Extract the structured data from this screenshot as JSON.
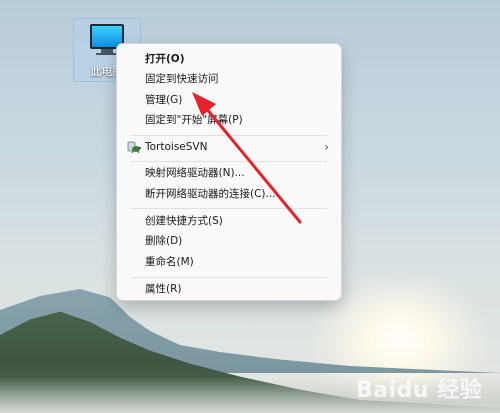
{
  "desktop": {
    "icon_label": "此电脑"
  },
  "context_menu": {
    "items": [
      {
        "label": "打开(O)"
      },
      {
        "label": "固定到快速访问"
      },
      {
        "label": "管理(G)"
      },
      {
        "label": "固定到\"开始\"屏幕(P)"
      },
      {
        "label": "TortoiseSVN",
        "icon": "tortoisesvn-icon",
        "has_submenu": true
      },
      {
        "label": "映射网络驱动器(N)..."
      },
      {
        "label": "断开网络驱动器的连接(C)..."
      },
      {
        "label": "创建快捷方式(S)"
      },
      {
        "label": "删除(D)"
      },
      {
        "label": "重命名(M)"
      },
      {
        "label": "属性(R)"
      }
    ]
  },
  "annotation": {
    "arrow_color": "#e8202a",
    "points_to": "管理(G)"
  },
  "watermark": {
    "text": "Baidu 经验"
  }
}
